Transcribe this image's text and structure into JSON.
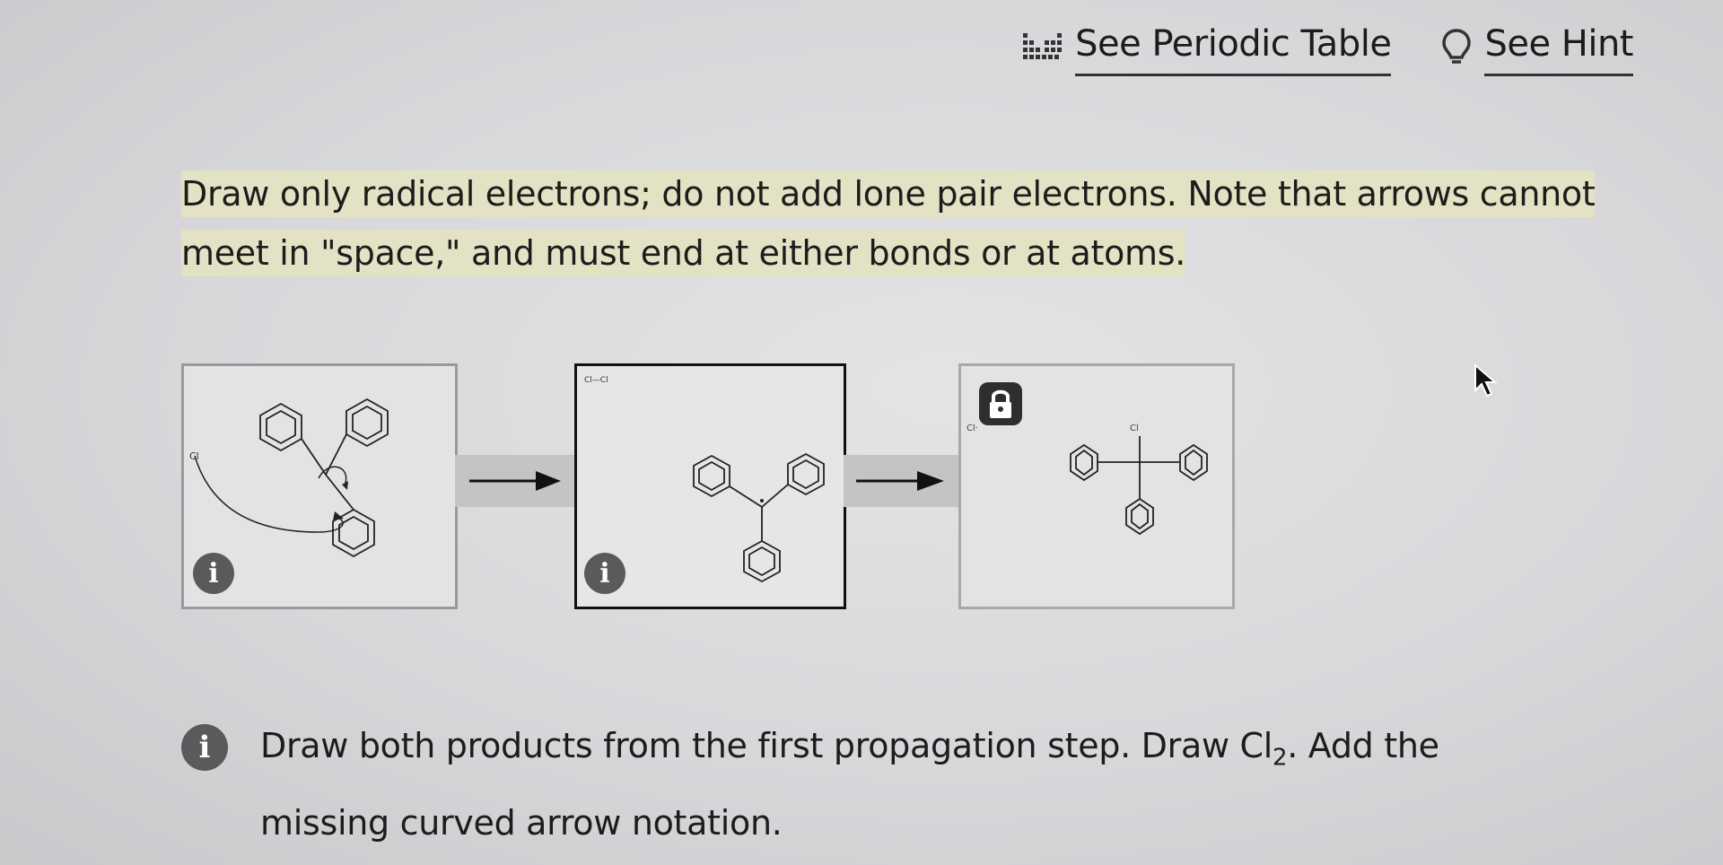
{
  "toolbar": {
    "periodic_table_label": "See Periodic Table",
    "periodic_table_icon": "periodic-table-icon",
    "hint_label": "See Hint",
    "hint_icon": "lightbulb-icon"
  },
  "instruction": "Draw only radical electrons; do not add lone pair electrons. Note that arrows cannot meet in \"space,\" and must end at either bonds or at atoms.",
  "panels": [
    {
      "atom_label": "Cl",
      "info_icon": "i"
    },
    {
      "atom_label": "Cl—Cl",
      "info_icon": "i"
    },
    {
      "atom_label": "Cl·",
      "substituent_label": "Cl",
      "lock_icon": "lock-icon"
    }
  ],
  "bottom_note": {
    "prefix": "Draw both products from the first propagation step. Draw Cl",
    "subscript": "2",
    "suffix": ". Add the missing curved arrow notation.",
    "info_icon": "i"
  },
  "colors": {
    "highlight": "#e3e2c4",
    "panel_bg": "#e3e3e5",
    "icon_bg": "#5a5a5c"
  }
}
